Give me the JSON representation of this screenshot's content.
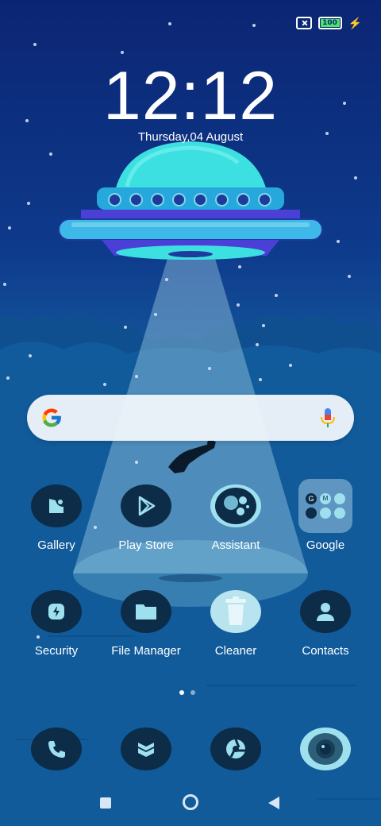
{
  "status_bar": {
    "battery_level": "100",
    "battery_percent": 100
  },
  "lock": {
    "time": "12:12",
    "date": "Thursday,04 August"
  },
  "search": {
    "placeholder": ""
  },
  "apps_row1": [
    {
      "label": "Gallery",
      "icon": "gallery-icon"
    },
    {
      "label": "Play Store",
      "icon": "play-store-icon"
    },
    {
      "label": "Assistant",
      "icon": "assistant-icon"
    },
    {
      "label": "Google",
      "icon": "google-folder-icon"
    }
  ],
  "apps_row2": [
    {
      "label": "Security",
      "icon": "security-icon"
    },
    {
      "label": "File Manager",
      "icon": "folder-icon"
    },
    {
      "label": "Cleaner",
      "icon": "trash-icon"
    },
    {
      "label": "Contacts",
      "icon": "person-icon"
    }
  ],
  "dock": [
    {
      "icon": "phone-icon"
    },
    {
      "icon": "messages-icon"
    },
    {
      "icon": "browser-icon"
    },
    {
      "icon": "camera-icon"
    }
  ],
  "pages": {
    "count": 2,
    "current": 1
  },
  "colors": {
    "icon_bg": "#0c2c48",
    "accent": "#7fd9ec",
    "ufo": "#3de0e0"
  }
}
